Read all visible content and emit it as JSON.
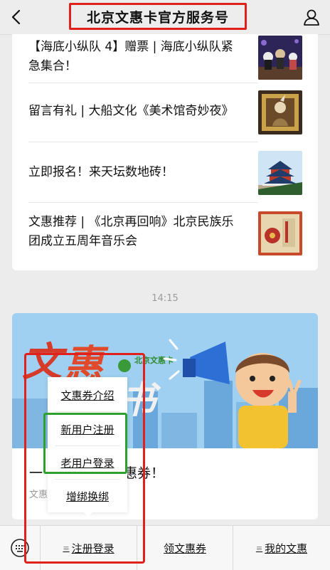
{
  "header": {
    "title": "北京文惠卡官方服务号",
    "back_icon": "chevron-left-icon",
    "user_icon": "user-icon"
  },
  "articles": [
    {
      "line1": "【海底小纵队 4】赠票 | 海底小纵队紧",
      "line2": "急集合！",
      "thumb": "sea-show-thumb"
    },
    {
      "line1": "留言有礼 | 大船文化《美术馆奇妙夜》",
      "line2": "",
      "thumb": "museum-night-thumb"
    },
    {
      "line1": "立即报名！来天坛数地砖！",
      "line2": "",
      "thumb": "temple-of-heaven-thumb"
    },
    {
      "line1": "文惠推荐 | 《北京再回响》北京民族乐",
      "line2": "团成立五周年音乐会",
      "thumb": "beijing-concert-thumb"
    }
  ],
  "time": "14:15",
  "banner": {
    "big_text": "文惠",
    "big_text2": "书",
    "title_left": "一",
    "title_right": "惠券！",
    "sub": "文惠"
  },
  "popup_menu": {
    "items": [
      "文惠券介绍",
      "新用户注册",
      "老用户登录",
      "增绑换绑"
    ]
  },
  "bottom_bar": {
    "keyboard_icon": "keyboard-icon",
    "tabs": [
      "注册登录",
      "领文惠券",
      "我的文惠"
    ]
  },
  "colors": {
    "annotation_red": "#e0201a",
    "annotation_green": "#2ea02e"
  }
}
